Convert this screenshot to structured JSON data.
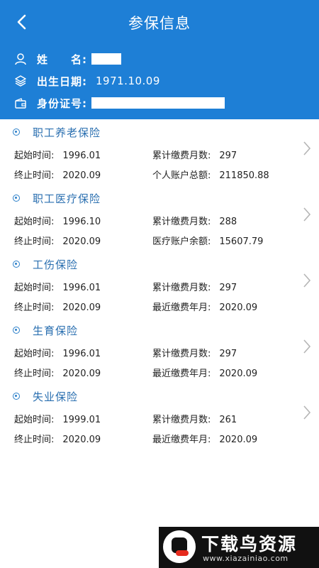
{
  "header": {
    "title": "参保信息",
    "name_label": "姓　　名:",
    "birth_label": "出生日期:",
    "birth_value": "1971.10.09",
    "id_label": "身份证号:"
  },
  "sections": [
    {
      "title": "职工养老保险",
      "start_label": "起始时间:",
      "start_value": "1996.01",
      "months_label": "累计缴费月数:",
      "months_value": "297",
      "end_label": "终止时间:",
      "end_value": "2020.09",
      "extra_label": "个人账户总额:",
      "extra_value": "211850.88"
    },
    {
      "title": "职工医疗保险",
      "start_label": "起始时间:",
      "start_value": "1996.10",
      "months_label": "累计缴费月数:",
      "months_value": "288",
      "end_label": "终止时间:",
      "end_value": "2020.09",
      "extra_label": "医疗账户余额:",
      "extra_value": "15607.79"
    },
    {
      "title": "工伤保险",
      "start_label": "起始时间:",
      "start_value": "1996.01",
      "months_label": "累计缴费月数:",
      "months_value": "297",
      "end_label": "终止时间:",
      "end_value": "2020.09",
      "extra_label": "最近缴费年月:",
      "extra_value": "2020.09"
    },
    {
      "title": "生育保险",
      "start_label": "起始时间:",
      "start_value": "1996.01",
      "months_label": "累计缴费月数:",
      "months_value": "297",
      "end_label": "终止时间:",
      "end_value": "2020.09",
      "extra_label": "最近缴费年月:",
      "extra_value": "2020.09"
    },
    {
      "title": "失业保险",
      "start_label": "起始时间:",
      "start_value": "1999.01",
      "months_label": "累计缴费月数:",
      "months_value": "261",
      "end_label": "终止时间:",
      "end_value": "2020.09",
      "extra_label": "最近缴费年月:",
      "extra_value": "2020.09"
    }
  ],
  "watermark": {
    "cn": "下载鸟资源",
    "en": "www.xiazainiao.com"
  },
  "colors": {
    "header_bg": "#1e7fd6",
    "section_title": "#2a6fb0",
    "chevron": "#b5b5b5"
  }
}
